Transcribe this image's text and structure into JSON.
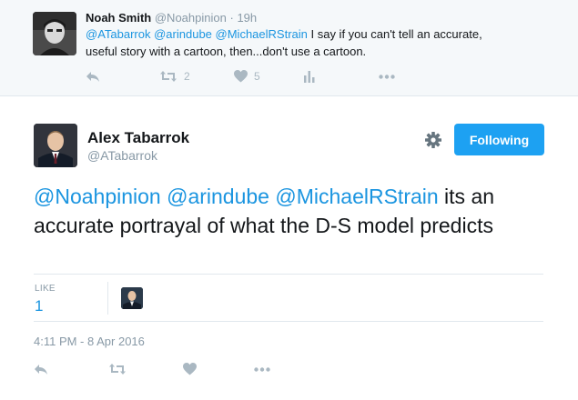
{
  "parent_tweet": {
    "author_name": "Noah Smith",
    "handle": "@Noahpinion",
    "separator": "·",
    "time": "19h",
    "mentions": [
      "@ATabarrok",
      "@arindube",
      "@MichaelRStrain"
    ],
    "text_line1": " I say if you can't tell an accurate,",
    "text_line2": "useful story with a cartoon, then...don't use a cartoon.",
    "actions": [
      {
        "icon": "reply-icon",
        "count": ""
      },
      {
        "icon": "retweet-icon",
        "count": "2"
      },
      {
        "icon": "like-heart-icon",
        "count": "5"
      },
      {
        "icon": "analytics-icon",
        "count": ""
      },
      {
        "icon": "more-dots-icon",
        "count": ""
      }
    ]
  },
  "main_tweet": {
    "author_name": "Alex Tabarrok",
    "handle": "@ATabarrok",
    "follow_button": "Following",
    "settings_icon": "gear-icon",
    "mentions": [
      "@Noahpinion",
      "@arindube",
      "@MichaelRStrain"
    ],
    "text": " its an accurate portrayal of what the D-S model predicts",
    "like_label": "LIKE",
    "like_count": "1",
    "timestamp": "4:11 PM - 8 Apr 2016",
    "actions": [
      "reply-icon",
      "retweet-icon",
      "like-heart-icon",
      "more-dots-icon"
    ]
  },
  "colors": {
    "accent": "#1da1f2",
    "link": "#1b95e0",
    "muted": "#8899a6",
    "icon": "#aab8c2",
    "parent_bg": "#f5f8fa",
    "border": "#e1e8ed"
  }
}
